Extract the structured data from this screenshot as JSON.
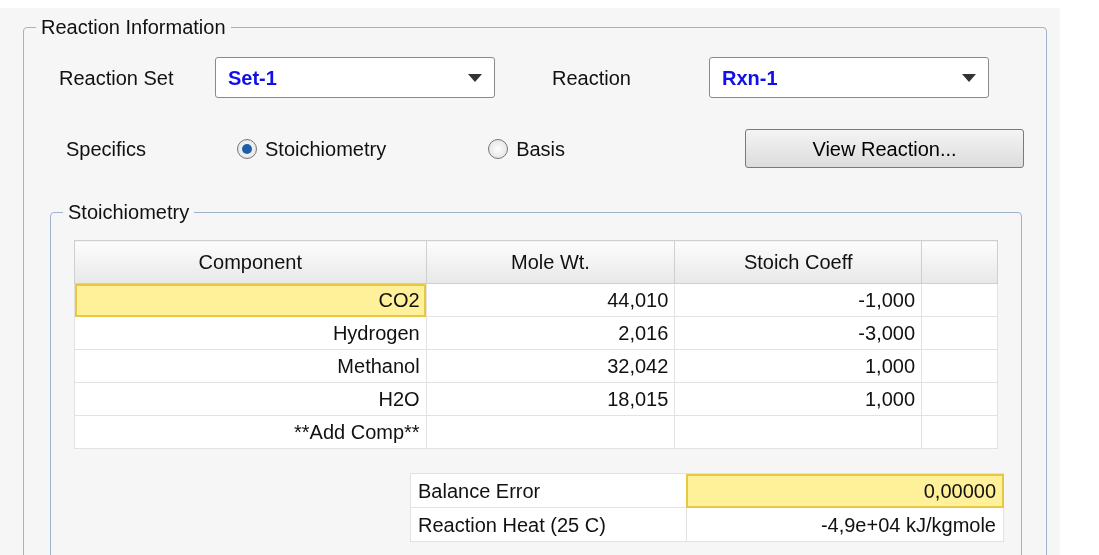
{
  "section": {
    "title": "Reaction Information"
  },
  "reaction_set": {
    "label": "Reaction Set",
    "value": "Set-1"
  },
  "reaction": {
    "label": "Reaction",
    "value": "Rxn-1"
  },
  "specifics": {
    "label": "Specifics",
    "options": [
      {
        "label": "Stoichiometry",
        "selected": true
      },
      {
        "label": "Basis",
        "selected": false
      }
    ]
  },
  "view_button": "View Reaction...",
  "stoichiometry": {
    "title": "Stoichiometry",
    "columns": [
      "Component",
      "Mole Wt.",
      "Stoich Coeff"
    ],
    "rows": [
      {
        "component": "CO2",
        "mole_wt": "44,010",
        "coeff": "-1,000",
        "selected": true
      },
      {
        "component": "Hydrogen",
        "mole_wt": "2,016",
        "coeff": "-3,000",
        "selected": false
      },
      {
        "component": "Methanol",
        "mole_wt": "32,042",
        "coeff": "1,000",
        "selected": false
      },
      {
        "component": "H2O",
        "mole_wt": "18,015",
        "coeff": "1,000",
        "selected": false
      },
      {
        "component": "**Add Comp**",
        "selected": false
      }
    ]
  },
  "summary": [
    {
      "label": "Balance Error",
      "value": "0,00000",
      "selected": true
    },
    {
      "label": "Reaction Heat (25 C)",
      "value": "-4,9e+04 kJ/kgmole",
      "selected": false
    }
  ]
}
